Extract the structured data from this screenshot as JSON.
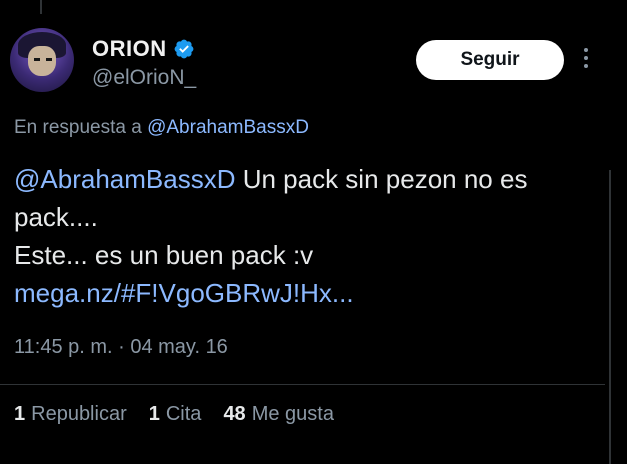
{
  "user": {
    "name": "ORION",
    "handle": "@elOrioN_",
    "verified": true
  },
  "follow_button_label": "Seguir",
  "reply_context": {
    "prefix": "En respuesta a ",
    "mention": "@AbrahamBassxD"
  },
  "tweet": {
    "mention": "@AbrahamBassxD",
    "line1_rest": " Un pack sin pezon no es",
    "line2": "pack....",
    "line3": "Este... es un buen pack :v",
    "link": "mega.nz/#F!VgoGBRwJ!Hx..."
  },
  "timestamp": "11:45 p. m. · 04 may. 16",
  "stats": [
    {
      "count": "1",
      "label": "Republicar"
    },
    {
      "count": "1",
      "label": "Cita"
    },
    {
      "count": "48",
      "label": "Me gusta"
    }
  ],
  "colors": {
    "background": "#000000",
    "link": "#8cb9ff",
    "secondary_text": "#8b98a5",
    "verified": "#1d9bf0"
  },
  "icons": {
    "verified": "verified-badge-icon",
    "more": "more-options-icon"
  }
}
